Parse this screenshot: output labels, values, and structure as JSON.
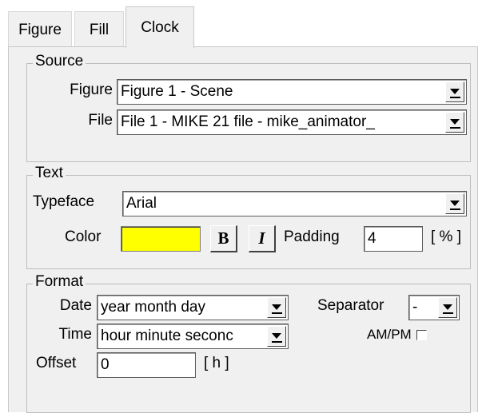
{
  "tabs": [
    {
      "label": "Figure"
    },
    {
      "label": "Fill"
    },
    {
      "label": "Clock"
    }
  ],
  "source": {
    "title": "Source",
    "figure_label": "Figure",
    "figure_value": "Figure 1 - Scene",
    "file_label": "File",
    "file_value": "File 1 - MIKE 21 file - mike_animator_"
  },
  "text": {
    "title": "Text",
    "typeface_label": "Typeface",
    "typeface_value": "Arial",
    "color_label": "Color",
    "color_value": "#ffff00",
    "bold_label": "B",
    "italic_label": "I",
    "padding_label": "Padding",
    "padding_value": "4",
    "padding_unit": "[ % ]"
  },
  "format": {
    "title": "Format",
    "date_label": "Date",
    "date_value": "year month day",
    "separator_label": "Separator",
    "separator_value": "-",
    "time_label": "Time",
    "time_value": "hour minute seconc",
    "ampm_label": "AM/PM",
    "ampm_checked": false,
    "offset_label": "Offset",
    "offset_value": "0",
    "offset_unit": "[ h ]"
  }
}
